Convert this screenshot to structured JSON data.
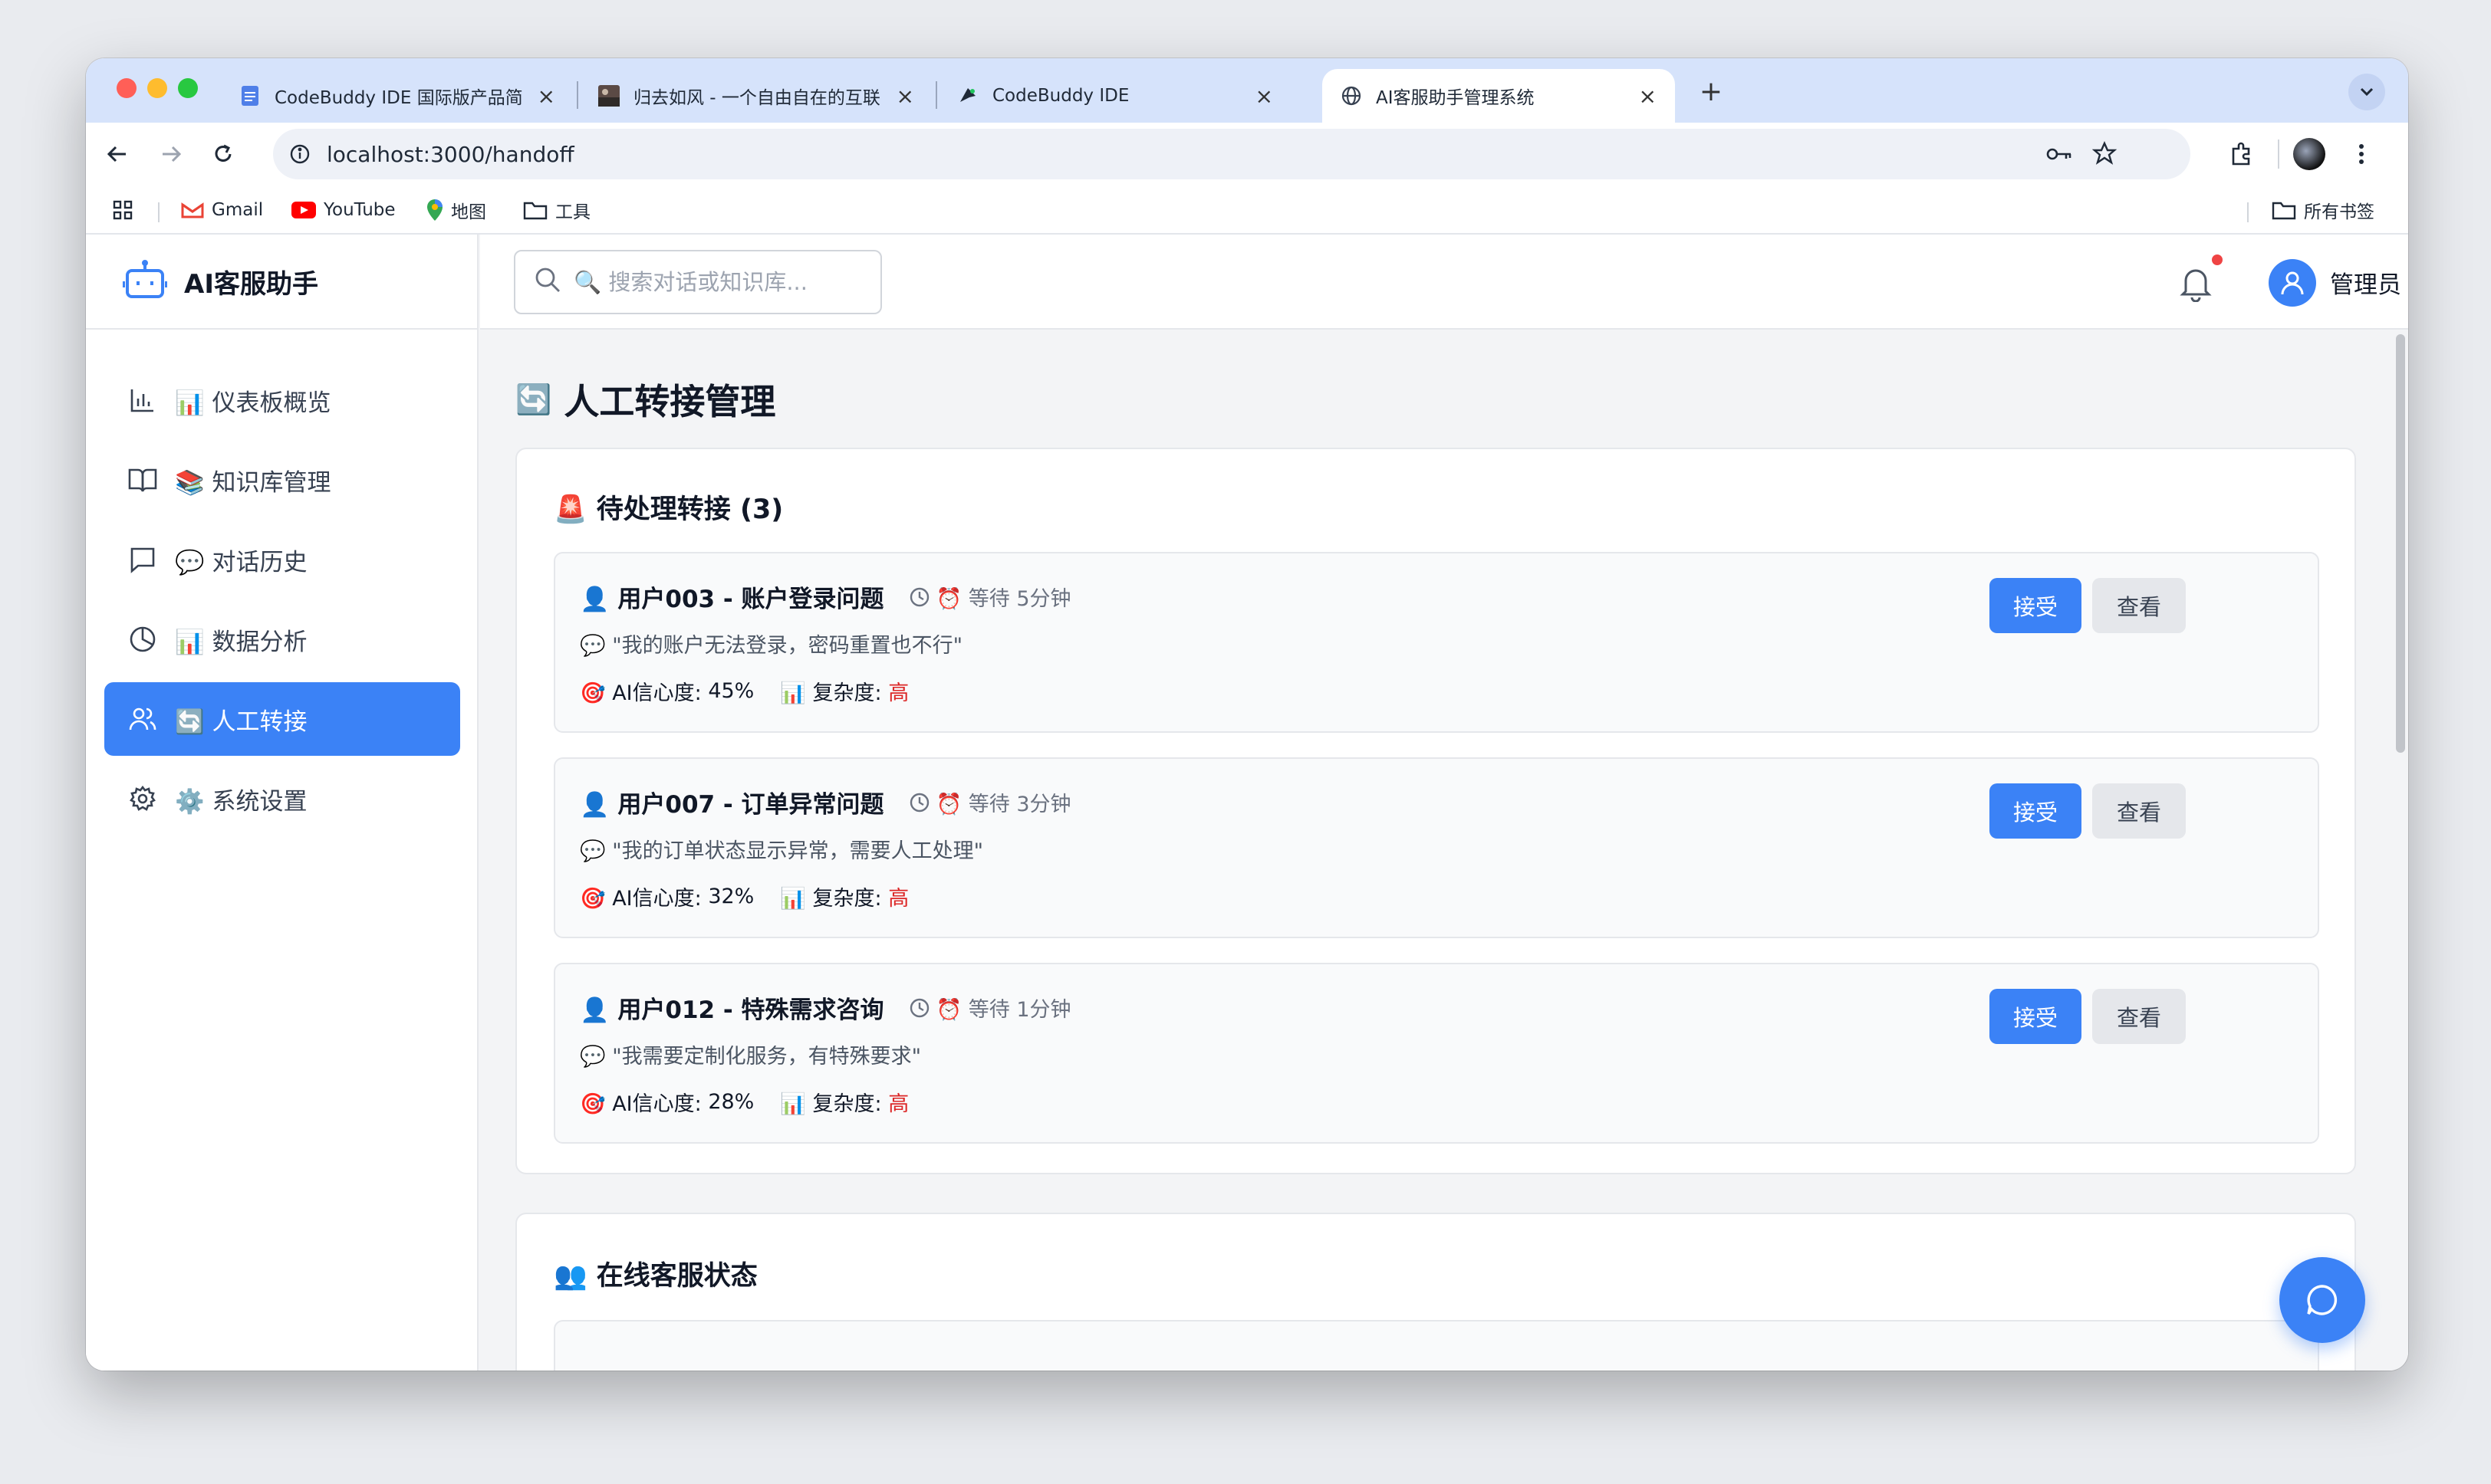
{
  "browser": {
    "tabs": [
      {
        "title": "CodeBuddy IDE 国际版产品简",
        "icon": "doc-icon"
      },
      {
        "title": "归去如风 - 一个自由自在的互联",
        "icon": "image-thumb-icon"
      },
      {
        "title": "CodeBuddy IDE",
        "icon": "codebuddy-icon"
      },
      {
        "title": "AI客服助手管理系统",
        "icon": "globe-icon"
      }
    ],
    "url": "localhost:3000/handoff",
    "bookmarks": [
      "Gmail",
      "YouTube",
      "地图",
      "工具"
    ],
    "all_bookmarks": "所有书签"
  },
  "app": {
    "brand": "AI客服助手",
    "search_placeholder": "🔍 搜索对话或知识库...",
    "user": "管理员",
    "nav": [
      {
        "label": "📊 仪表板概览",
        "icon": "bar-chart-icon"
      },
      {
        "label": "📚 知识库管理",
        "icon": "book-icon"
      },
      {
        "label": "💬 对话历史",
        "icon": "message-icon"
      },
      {
        "label": "📊 数据分析",
        "icon": "pie-chart-icon"
      },
      {
        "label": "🔄 人工转接",
        "icon": "users-icon",
        "active": true
      },
      {
        "label": "⚙️ 系统设置",
        "icon": "gear-icon"
      }
    ]
  },
  "page": {
    "title": "人工转接管理",
    "title_emoji": "🔄",
    "pending_title": "🚨 待处理转接 (3)",
    "online_title": "👥 在线客服状态",
    "accept_label": "接受",
    "view_label": "查看",
    "confidence_label": "🎯 AI信心度:",
    "complexity_label": "📊 复杂度:",
    "transfers": [
      {
        "name": "👤 用户003 - 账户登录问题",
        "wait": "⏰ 等待 5分钟",
        "quote": "💬 \"我的账户无法登录，密码重置也不行\"",
        "confidence": "45%",
        "complexity": "高"
      },
      {
        "name": "👤 用户007 - 订单异常问题",
        "wait": "⏰ 等待 3分钟",
        "quote": "💬 \"我的订单状态显示异常，需要人工处理\"",
        "confidence": "32%",
        "complexity": "高"
      },
      {
        "name": "👤 用户012 - 特殊需求咨询",
        "wait": "⏰ 等待 1分钟",
        "quote": "💬 \"我需要定制化服务，有特殊要求\"",
        "confidence": "28%",
        "complexity": "高"
      }
    ]
  },
  "colors": {
    "primary": "#3b82f6",
    "danger": "#dc2626",
    "tabstrip": "#d6e3fb"
  }
}
